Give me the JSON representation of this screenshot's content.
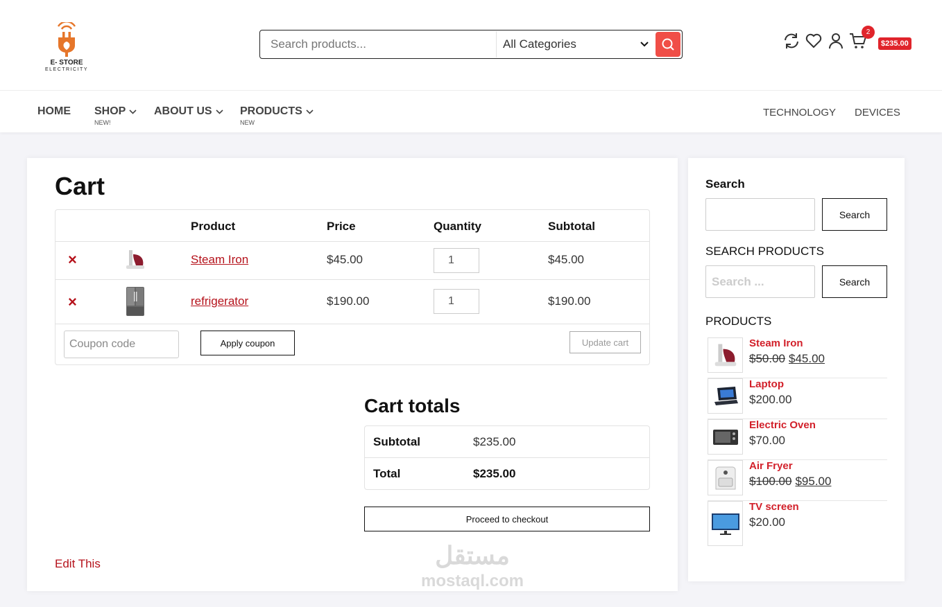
{
  "brand": {
    "name": "E- STORE",
    "tagline": "ELECTRICITY",
    "accent_color": "#e0242b",
    "logo_color": "#e6762a"
  },
  "search": {
    "placeholder": "Search products...",
    "category": "All Categories"
  },
  "header_icons": [
    "refresh-icon",
    "heart-icon",
    "user-icon",
    "cart-icon"
  ],
  "cart_badge": {
    "count": "2",
    "amount": "$235.00"
  },
  "nav": {
    "items": [
      {
        "label": "HOME"
      },
      {
        "label": "SHOP",
        "sub": "NEW!"
      },
      {
        "label": "ABOUT US"
      },
      {
        "label": "PRODUCTS",
        "sub": "NEW"
      }
    ],
    "right": [
      "TECHNOLOGY",
      "DEVICES"
    ]
  },
  "cart": {
    "title": "Cart",
    "headers": {
      "product": "Product",
      "price": "Price",
      "quantity": "Quantity",
      "subtotal": "Subtotal"
    },
    "rows": [
      {
        "name": "Steam Iron",
        "price": "$45.00",
        "qty": "1",
        "subtotal": "$45.00",
        "remove": "×"
      },
      {
        "name": "refrigerator",
        "price": "$190.00",
        "qty": "1",
        "subtotal": "$190.00",
        "remove": "×"
      }
    ],
    "coupon_placeholder": "Coupon code",
    "apply_label": "Apply coupon",
    "update_label": "Update cart"
  },
  "totals": {
    "title": "Cart totals",
    "subtotal_label": "Subtotal",
    "subtotal_value": "$235.00",
    "total_label": "Total",
    "total_value": "$235.00",
    "checkout_label": "Proceed to checkout"
  },
  "edit_link": "Edit This",
  "watermark": {
    "arabic": "مستقل",
    "latin": "mostaql.com"
  },
  "sidebar": {
    "search_heading": "Search",
    "search_button": "Search",
    "search_products_heading": "SEARCH PRODUCTS",
    "search_products_placeholder": "Search ...",
    "search_products_button": "Search",
    "products_heading": "PRODUCTS",
    "products": [
      {
        "name": "Steam Iron",
        "old_price": "$50.00",
        "price": "$45.00"
      },
      {
        "name": "Laptop",
        "price": "$200.00"
      },
      {
        "name": "Electric Oven",
        "price": "$70.00"
      },
      {
        "name": "Air Fryer",
        "old_price": "$100.00",
        "price": "$95.00"
      },
      {
        "name": "TV screen",
        "price": "$20.00"
      }
    ]
  }
}
